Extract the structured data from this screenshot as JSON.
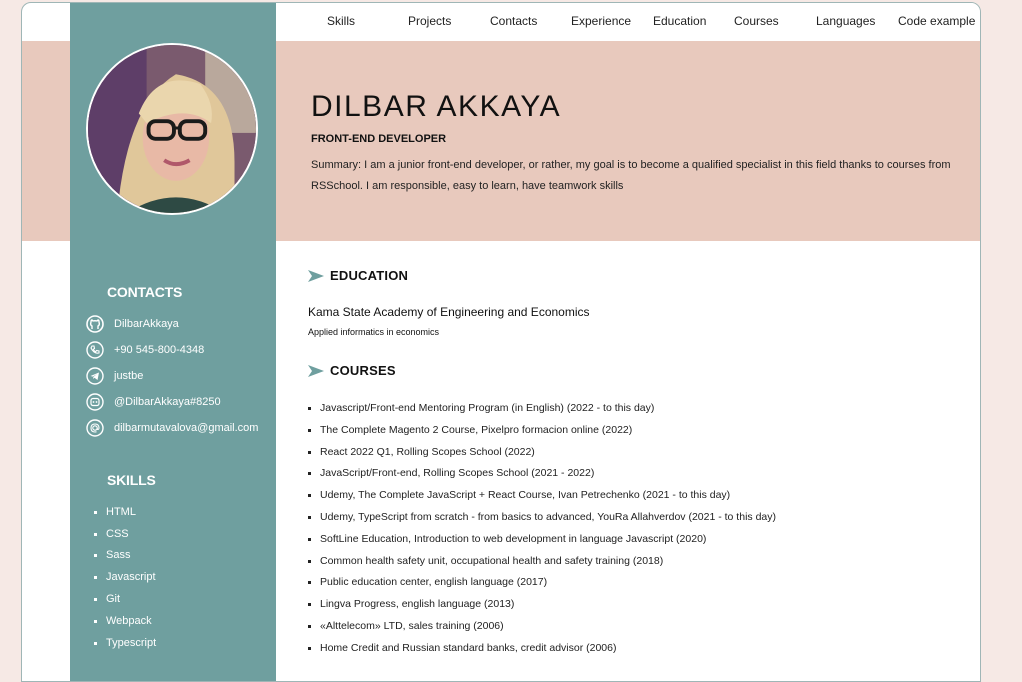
{
  "nav": {
    "items": [
      "Skills",
      "Projects",
      "Contacts",
      "Experience",
      "Education",
      "Courses",
      "Languages",
      "Code example"
    ]
  },
  "header": {
    "name": "DILBAR AKKAYA",
    "role": "FRONT-END DEVELOPER",
    "summary": "Summary: I am a junior front-end developer, or rather, my goal is to become a qualified specialist in this field thanks to courses from RSSchool. I am responsible, easy to learn, have teamwork skills"
  },
  "sidebar": {
    "contacts_heading": "CONTACTS",
    "contacts": [
      {
        "icon": "github-icon",
        "text": "DilbarAkkaya"
      },
      {
        "icon": "phone-icon",
        "text": "+90 545-800-4348"
      },
      {
        "icon": "telegram-icon",
        "text": "justbe"
      },
      {
        "icon": "discord-icon",
        "text": "@DilbarAkkaya#8250"
      },
      {
        "icon": "email-icon",
        "text": "dilbarmutavalova@gmail.com"
      }
    ],
    "skills_heading": "SKILLS",
    "skills": [
      "HTML",
      "CSS",
      "Sass",
      "Javascript",
      "Git",
      "Webpack",
      "Typescript"
    ]
  },
  "education": {
    "heading": "EDUCATION",
    "institution": "Kama State Academy of Engineering and Economics",
    "speciality": "Applied informatics in economics"
  },
  "courses": {
    "heading": "COURSES",
    "items": [
      "Javascript/Front-end Mentoring Program (in English) (2022 - to this day)",
      "The Complete Magento 2 Course, Pixelpro formacion online (2022)",
      "React 2022 Q1, Rolling Scopes School (2022)",
      "JavaScript/Front-end, Rolling Scopes School (2021 - 2022)",
      "Udemy, The Complete JavaScript + React Course, Ivan Petrechenko (2021 - to this day)",
      "Udemy, TypeScript from scratch - from basics to advanced, YouRa Allahverdov (2021 - to this day)",
      "SoftLine Education, Introduction to web development in language Javascript (2020)",
      "Common health safety unit, occupational health and safety training (2018)",
      "Public education center, english language (2017)",
      "Lingva Progress, english language (2013)",
      "«Alttelecom» LTD, sales training (2006)",
      "Home Credit and Russian standard banks, credit advisor (2006)"
    ]
  },
  "colors": {
    "sidebar": "#6f9f9f",
    "hero": "#e8c9bd",
    "background": "#f6e9e5",
    "accent_arrow": "#6f9f9f"
  }
}
